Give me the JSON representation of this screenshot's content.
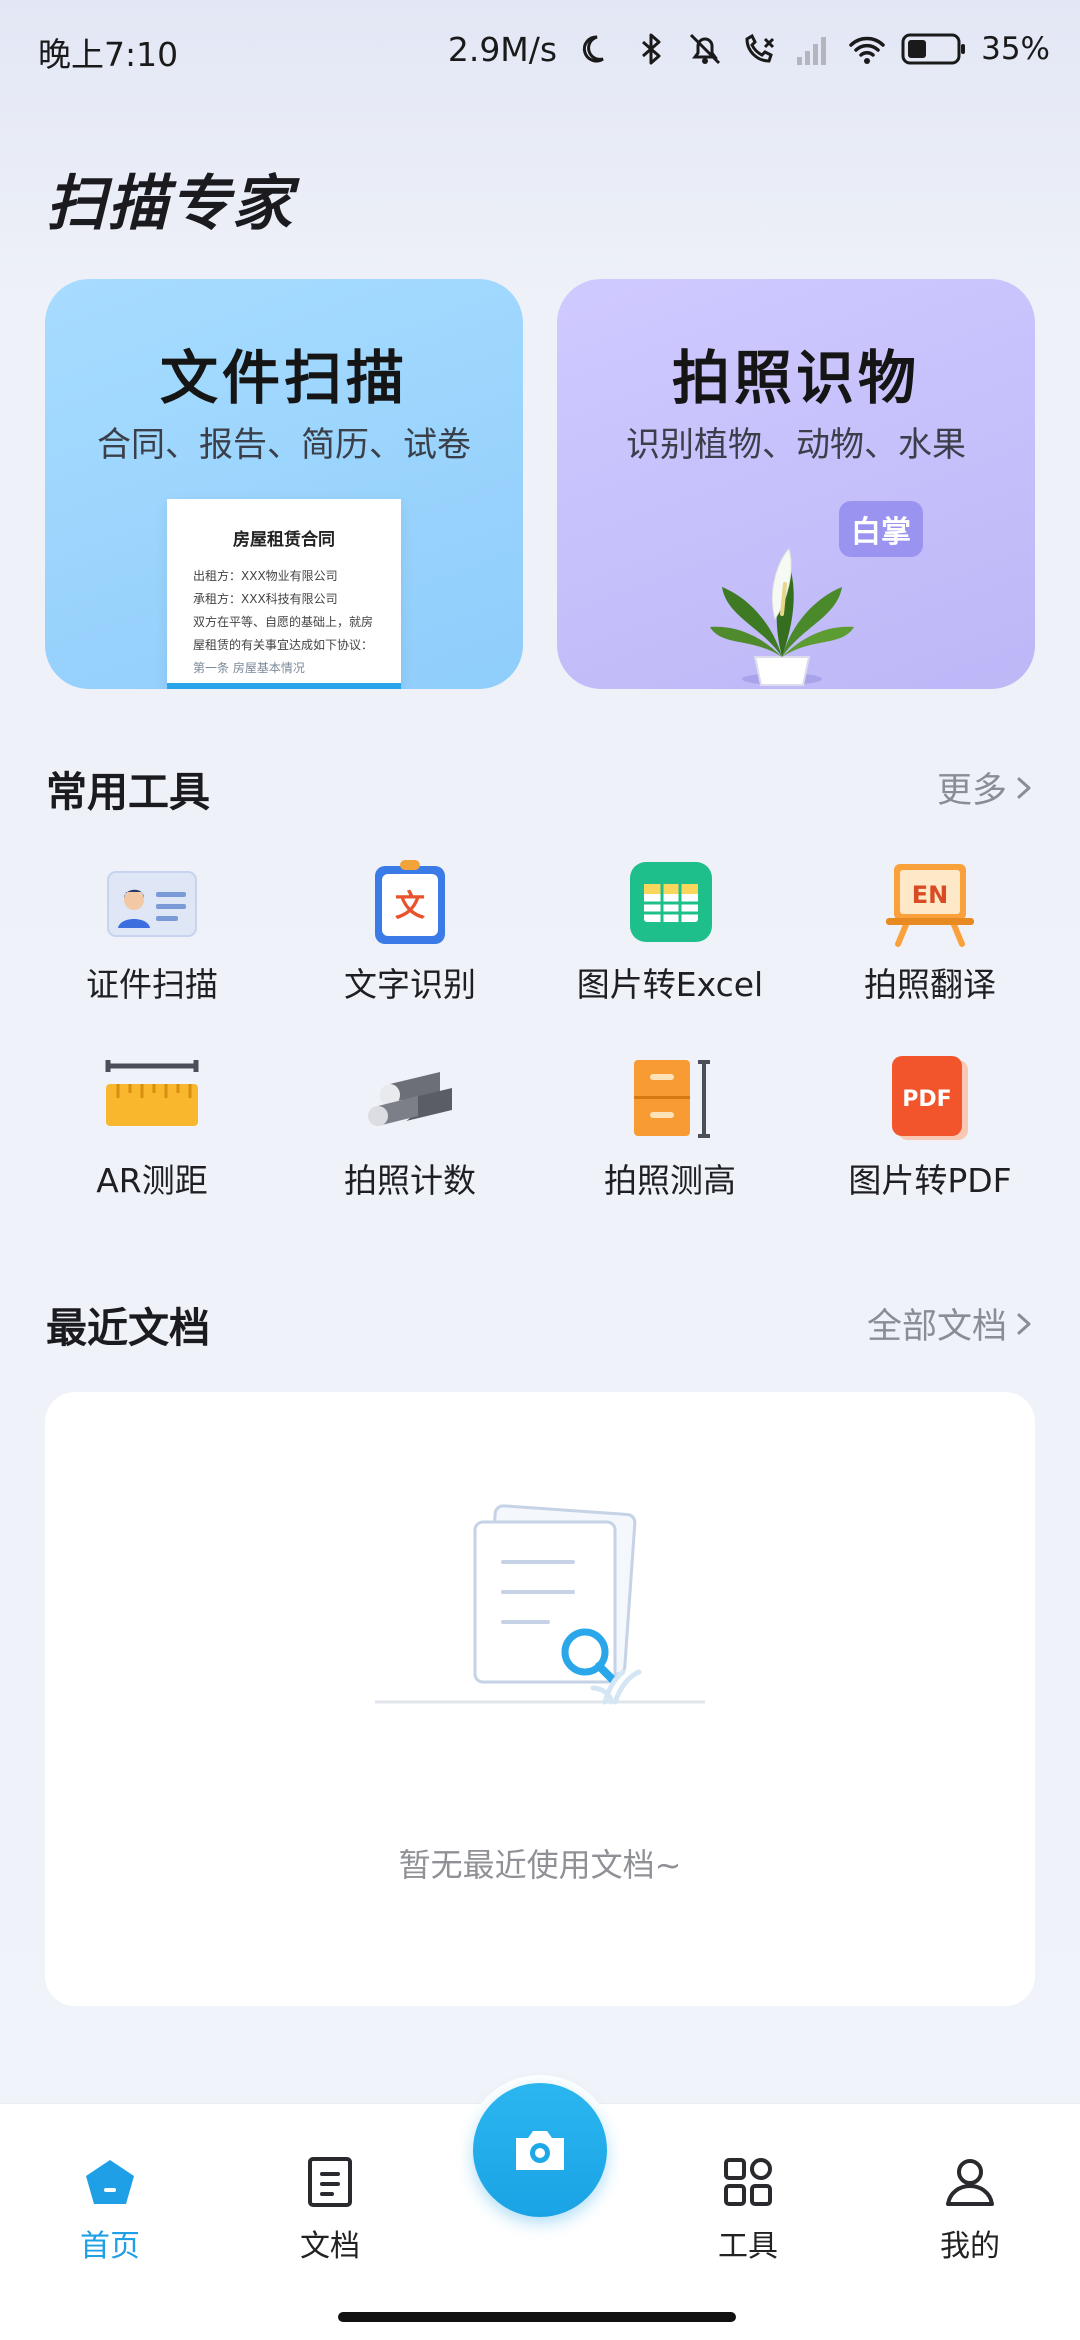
{
  "status_bar": {
    "time": "晚上7:10",
    "speed": "2.9M/s",
    "battery": "35%",
    "icons": [
      "moon-icon",
      "bluetooth-icon",
      "mute-icon",
      "call-icon",
      "signal-icon",
      "wifi-icon",
      "battery-icon"
    ]
  },
  "app": {
    "title": "扫描专家"
  },
  "hero": {
    "scan": {
      "title": "文件扫描",
      "subtitle": "合同、报告、简历、试卷",
      "doc": {
        "title": "房屋租赁合同",
        "lines": [
          "出租方：XXX物业有限公司",
          "承租方：XXX科技有限公司",
          "双方在平等、自愿的基础上，就房",
          "屋租赁的有关事宜达成如下协议：",
          "第一条  房屋基本情况"
        ]
      }
    },
    "identify": {
      "title": "拍照识物",
      "subtitle": "识别植物、动物、水果",
      "tag": "白掌"
    }
  },
  "tools_section": {
    "title": "常用工具",
    "more": "更多",
    "items": [
      {
        "label": "证件扫描",
        "icon": "id-card-icon"
      },
      {
        "label": "文字识别",
        "icon": "text-recognition-icon"
      },
      {
        "label": "图片转Excel",
        "icon": "excel-icon"
      },
      {
        "label": "拍照翻译",
        "icon": "translate-icon"
      },
      {
        "label": "AR测距",
        "icon": "ruler-icon"
      },
      {
        "label": "拍照计数",
        "icon": "pipes-count-icon"
      },
      {
        "label": "拍照测高",
        "icon": "height-measure-icon"
      },
      {
        "label": "图片转PDF",
        "icon": "pdf-icon"
      }
    ],
    "icon_text": {
      "translate": "EN",
      "text": "文",
      "pdf": "PDF"
    }
  },
  "recent_section": {
    "title": "最近文档",
    "more": "全部文档",
    "empty_text": "暂无最近使用文档~"
  },
  "bottom_nav": {
    "items": [
      {
        "label": "首页",
        "icon": "home-icon",
        "active": true
      },
      {
        "label": "文档",
        "icon": "document-icon"
      },
      {
        "label": "工具",
        "icon": "grid-icon"
      },
      {
        "label": "我的",
        "icon": "profile-icon"
      }
    ],
    "center": {
      "icon": "camera-icon"
    }
  },
  "colors": {
    "accent": "#1e9fe6",
    "scan_card": "#a7dcff",
    "identify_card": "#cfcaff"
  }
}
